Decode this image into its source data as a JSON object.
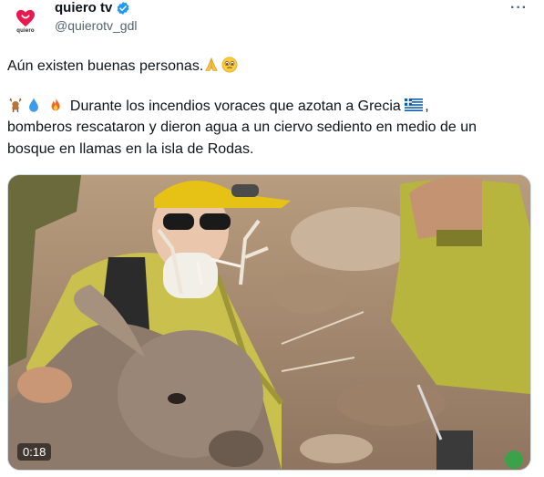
{
  "account": {
    "display_name": "quiero tv",
    "handle": "@quierotv_gdl",
    "avatar_brand": "quiero",
    "verified_icon": "verified-badge-icon",
    "more_label": "···"
  },
  "tweet": {
    "line1": "Aún existen buenas personas.",
    "line2": "Durante los incendios voraces que azotan a Grecia",
    "line3": "bomberos rescataron y dieron agua a un ciervo sediento en medio de un",
    "line4": "bosque en llamas en la isla de Rodas.",
    "emojis": [
      "pray-emoji",
      "teary-face-emoji",
      "deer-emoji",
      "droplet-emoji",
      "fire-emoji",
      "greece-flag-emoji"
    ]
  },
  "media": {
    "type": "video",
    "duration": "0:18"
  },
  "colors": {
    "text": "#0f1419",
    "secondary": "#536471",
    "verified": "#1d9bf0",
    "brand_heart": "#e8194f"
  }
}
